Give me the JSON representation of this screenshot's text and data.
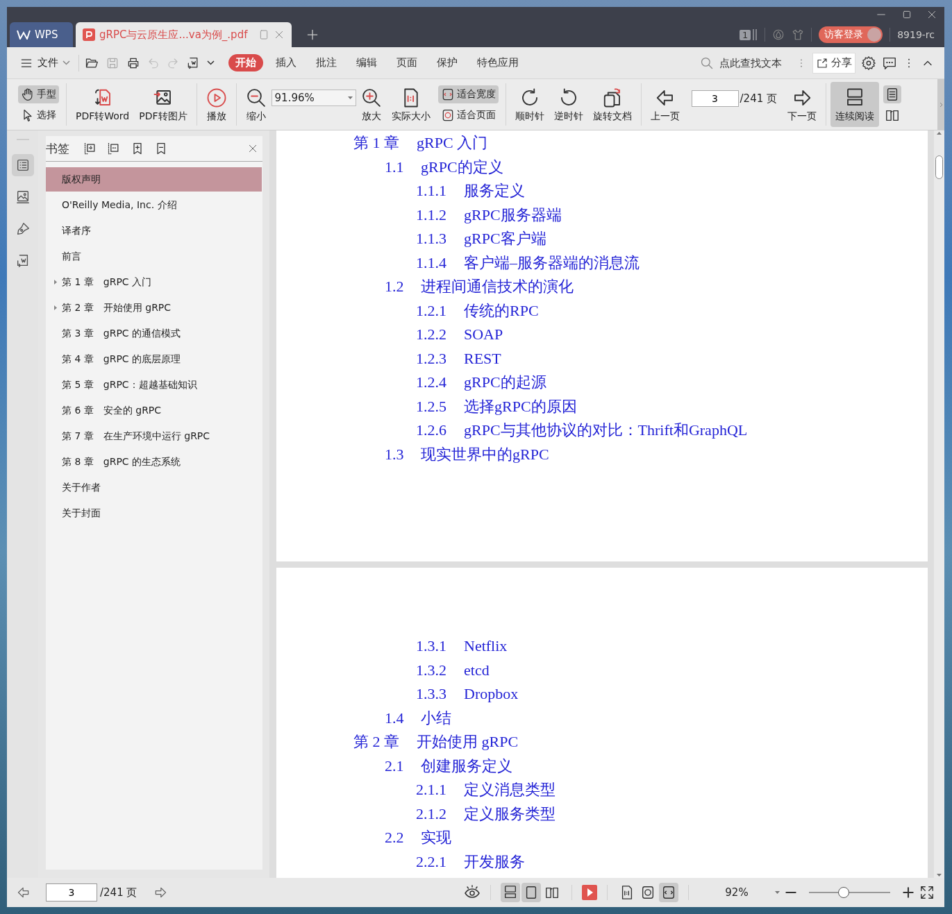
{
  "app_tabs": [
    {
      "kind": "home",
      "label": "WPS",
      "selected": false
    },
    {
      "kind": "document",
      "label": "gRPC与云原生应...va为例_.pdf",
      "selected": true
    }
  ],
  "title_bar": {
    "badge": "1",
    "login": "访客登录",
    "user": "8919-rc"
  },
  "menu": {
    "file": "文件",
    "tabs": [
      {
        "label": "开始",
        "selected": true
      },
      {
        "label": "插入",
        "selected": false
      },
      {
        "label": "批注",
        "selected": false
      },
      {
        "label": "编辑",
        "selected": false
      },
      {
        "label": "页面",
        "selected": false
      },
      {
        "label": "保护",
        "selected": false
      },
      {
        "label": "特色应用",
        "selected": false
      }
    ],
    "search": {
      "placeholder": "点此查找文本"
    },
    "share": "分享"
  },
  "toolbar": [
    {
      "kind": "stack",
      "items": [
        {
          "label": "手型",
          "selected": true
        },
        {
          "label": "选择",
          "selected": false
        }
      ]
    },
    {
      "kind": "separator"
    },
    {
      "kind": "tool",
      "label": "PDF转Word",
      "selected": false
    },
    {
      "kind": "tool",
      "label": "PDF转图片",
      "selected": false
    },
    {
      "kind": "separator"
    },
    {
      "kind": "tool",
      "label": "播放",
      "selected": false
    },
    {
      "kind": "separator"
    },
    {
      "kind": "tool",
      "label": "缩小",
      "selected": false
    },
    {
      "kind": "zoom",
      "value": "91.96%"
    },
    {
      "kind": "tool",
      "label": "放大",
      "selected": false
    },
    {
      "kind": "tool",
      "label": "实际大小",
      "selected": false
    },
    {
      "kind": "stack",
      "items": [
        {
          "label": "适合宽度",
          "selected": true
        },
        {
          "label": "适合页面",
          "selected": false
        }
      ]
    },
    {
      "kind": "separator"
    },
    {
      "kind": "tool",
      "label": "顺时针",
      "selected": false
    },
    {
      "kind": "tool",
      "label": "逆时针",
      "selected": false
    },
    {
      "kind": "tool",
      "label": "旋转文档",
      "selected": false
    },
    {
      "kind": "separator"
    },
    {
      "kind": "tool",
      "label": "上一页",
      "selected": false
    },
    {
      "kind": "pager",
      "value": "3",
      "total": "/241 页"
    },
    {
      "kind": "tool",
      "label": "下一页",
      "selected": false
    },
    {
      "kind": "separator"
    },
    {
      "kind": "tool",
      "label": "连续阅读",
      "selected": true
    },
    {
      "kind": "icon_stack",
      "items": [
        {
          "selected": true
        },
        {
          "selected": false
        }
      ]
    }
  ],
  "sidebar": {
    "rail": [
      {
        "selected": true
      },
      {
        "selected": false
      },
      {
        "selected": false
      },
      {
        "selected": false
      }
    ],
    "panel": {
      "title": "书签",
      "items": [
        {
          "kind": "leaf",
          "label": "版权声明",
          "selected": true
        },
        {
          "kind": "leaf",
          "label": "O'Reilly Media, Inc. 介绍",
          "selected": false
        },
        {
          "kind": "leaf",
          "label": "译者序",
          "selected": false
        },
        {
          "kind": "leaf",
          "label": "前言",
          "selected": false
        },
        {
          "kind": "branch",
          "label": "第 1 章　gRPC 入门",
          "selected": false,
          "expanded": false
        },
        {
          "kind": "branch",
          "label": "第 2 章　开始使用 gRPC",
          "selected": false,
          "expanded": false
        },
        {
          "kind": "leaf",
          "label": "第 3 章　gRPC 的通信模式",
          "selected": false
        },
        {
          "kind": "leaf",
          "label": "第 4 章　gRPC 的底层原理",
          "selected": false
        },
        {
          "kind": "leaf",
          "label": "第 5 章　gRPC：超越基础知识",
          "selected": false
        },
        {
          "kind": "leaf",
          "label": "第 6 章　安全的 gRPC",
          "selected": false
        },
        {
          "kind": "leaf",
          "label": "第 7 章　在生产环境中运行 gRPC",
          "selected": false
        },
        {
          "kind": "leaf",
          "label": "第 8 章　gRPC 的生态系统",
          "selected": false
        },
        {
          "kind": "leaf",
          "label": "关于作者",
          "selected": false
        },
        {
          "kind": "leaf",
          "label": "关于封面",
          "selected": false
        }
      ]
    }
  },
  "document": {
    "pages": [
      {
        "entries": [
          {
            "number": "第 1 章",
            "title": "gRPC 入门",
            "children": [
              {
                "number": "1.1",
                "title": "gRPC的定义",
                "children": [
                  {
                    "number": "1.1.1",
                    "title": "服务定义"
                  },
                  {
                    "number": "1.1.2",
                    "title": "gRPC服务器端"
                  },
                  {
                    "number": "1.1.3",
                    "title": "gRPC客户端"
                  },
                  {
                    "number": "1.1.4",
                    "title": "客户端–服务器端的消息流"
                  }
                ]
              },
              {
                "number": "1.2",
                "title": "进程间通信技术的演化",
                "children": [
                  {
                    "number": "1.2.1",
                    "title": "传统的RPC"
                  },
                  {
                    "number": "1.2.2",
                    "title": "SOAP"
                  },
                  {
                    "number": "1.2.3",
                    "title": "REST"
                  },
                  {
                    "number": "1.2.4",
                    "title": "gRPC的起源"
                  },
                  {
                    "number": "1.2.5",
                    "title": "选择gRPC的原因"
                  },
                  {
                    "number": "1.2.6",
                    "title": "gRPC与其他协议的对比：Thrift和GraphQL"
                  }
                ]
              },
              {
                "number": "1.3",
                "title": "现实世界中的gRPC"
              }
            ]
          }
        ]
      },
      {
        "entries": [
          {
            "children": [
              {
                "children": [
                  {
                    "number": "1.3.1",
                    "title": "Netflix"
                  },
                  {
                    "number": "1.3.2",
                    "title": "etcd"
                  },
                  {
                    "number": "1.3.3",
                    "title": "Dropbox"
                  }
                ]
              },
              {
                "number": "1.4",
                "title": "小结"
              }
            ]
          },
          {
            "number": "第 2 章",
            "title": "开始使用 gRPC",
            "children": [
              {
                "number": "2.1",
                "title": "创建服务定义",
                "children": [
                  {
                    "number": "2.1.1",
                    "title": "定义消息类型"
                  },
                  {
                    "number": "2.1.2",
                    "title": "定义服务类型"
                  }
                ]
              },
              {
                "number": "2.2",
                "title": "实现",
                "children": [
                  {
                    "number": "2.2.1",
                    "title": "开发服务"
                  }
                ]
              }
            ]
          }
        ]
      }
    ]
  },
  "status_bar": {
    "page": "3",
    "total": "/241 页",
    "view_modes": [
      {
        "selected": true
      },
      {
        "selected": true
      },
      {
        "selected": false
      }
    ],
    "fit_modes": [
      {
        "selected": false
      },
      {
        "selected": false
      },
      {
        "selected": true
      }
    ],
    "zoom": "92%",
    "zoom_slider": {
      "level": 0.43
    }
  }
}
